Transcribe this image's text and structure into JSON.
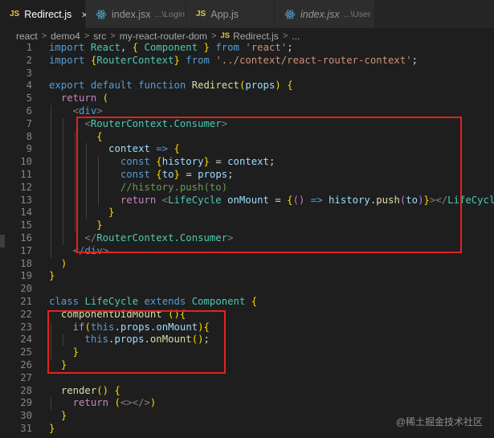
{
  "tabs": [
    {
      "name": "Redirect.js",
      "kind": "js",
      "active": true,
      "desc": "",
      "close": "×"
    },
    {
      "name": "index.jsx",
      "kind": "react",
      "active": false,
      "desc": "...\\Login",
      "close": ""
    },
    {
      "name": "App.js",
      "kind": "js",
      "active": false,
      "desc": "",
      "close": ""
    },
    {
      "name": "index.jsx",
      "kind": "react",
      "active": false,
      "desc": "...\\User",
      "close": ""
    }
  ],
  "breadcrumb": [
    "react",
    "demo4",
    "src",
    "my-react-router-dom",
    "Redirect.js",
    "..."
  ],
  "js_badge": "JS",
  "separator": ">",
  "line_numbers": [
    "1",
    "2",
    "3",
    "4",
    "5",
    "6",
    "7",
    "8",
    "9",
    "10",
    "11",
    "12",
    "13",
    "14",
    "15",
    "16",
    "17",
    "18",
    "19",
    "20",
    "21",
    "22",
    "23",
    "24",
    "25",
    "26",
    "27",
    "28",
    "29",
    "30",
    "31"
  ],
  "code_lines": [
    "import React, { Component } from 'react';",
    "import {RouterContext} from '../context/react-router-context';",
    "",
    "export default function Redirect(props) {",
    "  return (",
    "    <div>",
    "      <RouterContext.Consumer>",
    "        {",
    "          context => {",
    "            const {history} = context;",
    "            const {to} = props;",
    "            //history.push(to)",
    "            return <LifeCycle onMount = {() => history.push(to)}></LifeCycle>",
    "          }",
    "        }",
    "      </RouterContext.Consumer>",
    "    </div>",
    "  )",
    "}",
    "",
    "class LifeCycle extends Component {",
    "  componentDidMount (){",
    "    if(this.props.onMount){",
    "      this.props.onMount();",
    "    }",
    "  }",
    "",
    "  render() {",
    "    return (<></>)",
    "  }",
    "}"
  ],
  "watermark": "@稀土掘金技术社区",
  "colors": {
    "highlight_box": "#e1231f",
    "editor_bg": "#1e1e1e",
    "keyword": "#569cd6",
    "control": "#c586c0",
    "string": "#ce9178",
    "type": "#4ec9b0"
  }
}
